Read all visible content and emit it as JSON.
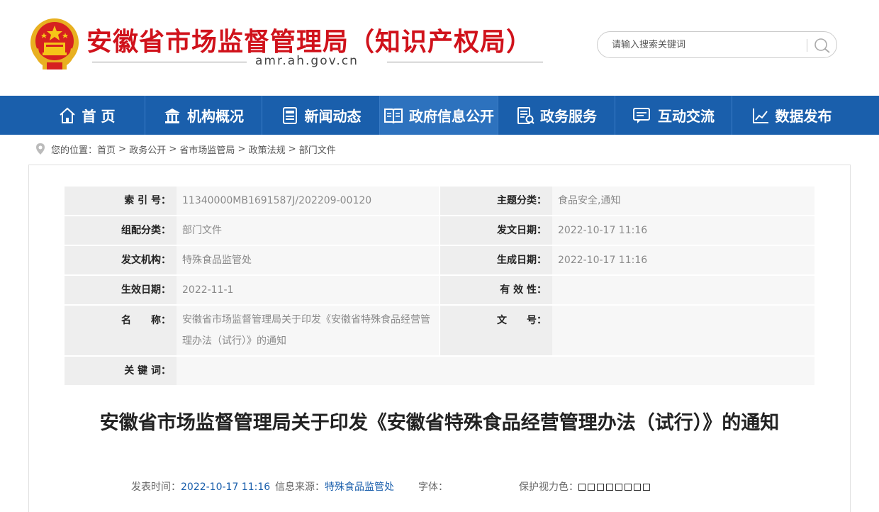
{
  "header": {
    "site_title": "安徽省市场监督管理局（知识产权局）",
    "domain": "amr.ah.gov.cn",
    "search_placeholder": "请输入搜索关键词"
  },
  "nav": [
    {
      "label": "首 页",
      "icon": "home-icon"
    },
    {
      "label": "机构概况",
      "icon": "building-icon"
    },
    {
      "label": "新闻动态",
      "icon": "news-icon"
    },
    {
      "label": "政府信息公开",
      "icon": "book-icon"
    },
    {
      "label": "政务服务",
      "icon": "service-icon"
    },
    {
      "label": "互动交流",
      "icon": "chat-icon"
    },
    {
      "label": "数据发布",
      "icon": "chart-icon"
    }
  ],
  "breadcrumb": {
    "prefix": "您的位置：",
    "items": [
      "首页",
      "政务公开",
      "省市场监管局",
      "政策法规",
      "部门文件"
    ],
    "separator": " > "
  },
  "meta": {
    "index_label": "索 引 号：",
    "index_value": "11340000MB1691587J/202209-00120",
    "topic_label": "主题分类：",
    "topic_value": "食品安全,通知",
    "group_label": "组配分类：",
    "group_value": "部门文件",
    "issue_date_label": "发文日期：",
    "issue_date_value": "2022-10-17 11:16",
    "issuer_label": "发文机构：",
    "issuer_value": "特殊食品监管处",
    "created_label": "生成日期：",
    "created_value": "2022-10-17 11:16",
    "effective_label": "生效日期：",
    "effective_value": "2022-11-1",
    "validity_label": "有 效 性：",
    "validity_value": "",
    "name_label": "名　　称：",
    "name_value": "安徽省市场监督管理局关于印发《安徽省特殊食品经营管理办法（试行）》的通知",
    "docno_label": "文　　号：",
    "docno_value": "",
    "keywords_label": "关 键 词：",
    "keywords_value": ""
  },
  "document": {
    "title": "安徽省市场监督管理局关于印发《安徽省特殊食品经营管理办法（试行）》的通知",
    "publish_time_label": "发表时间：",
    "publish_time": "2022-10-17 11:16",
    "source_label": "信息来源：",
    "source": "特殊食品监管处",
    "font_label": "字体：",
    "eye_label": "保护视力色："
  },
  "eye_colors": [
    "#ffffff",
    "#ffffff",
    "#ffffff",
    "#ffffff",
    "#ffffff",
    "#ffffff",
    "#ffffff",
    "#ffffff"
  ],
  "colors": {
    "brand_red": "#d0121b",
    "nav_blue": "#1a5fac"
  }
}
